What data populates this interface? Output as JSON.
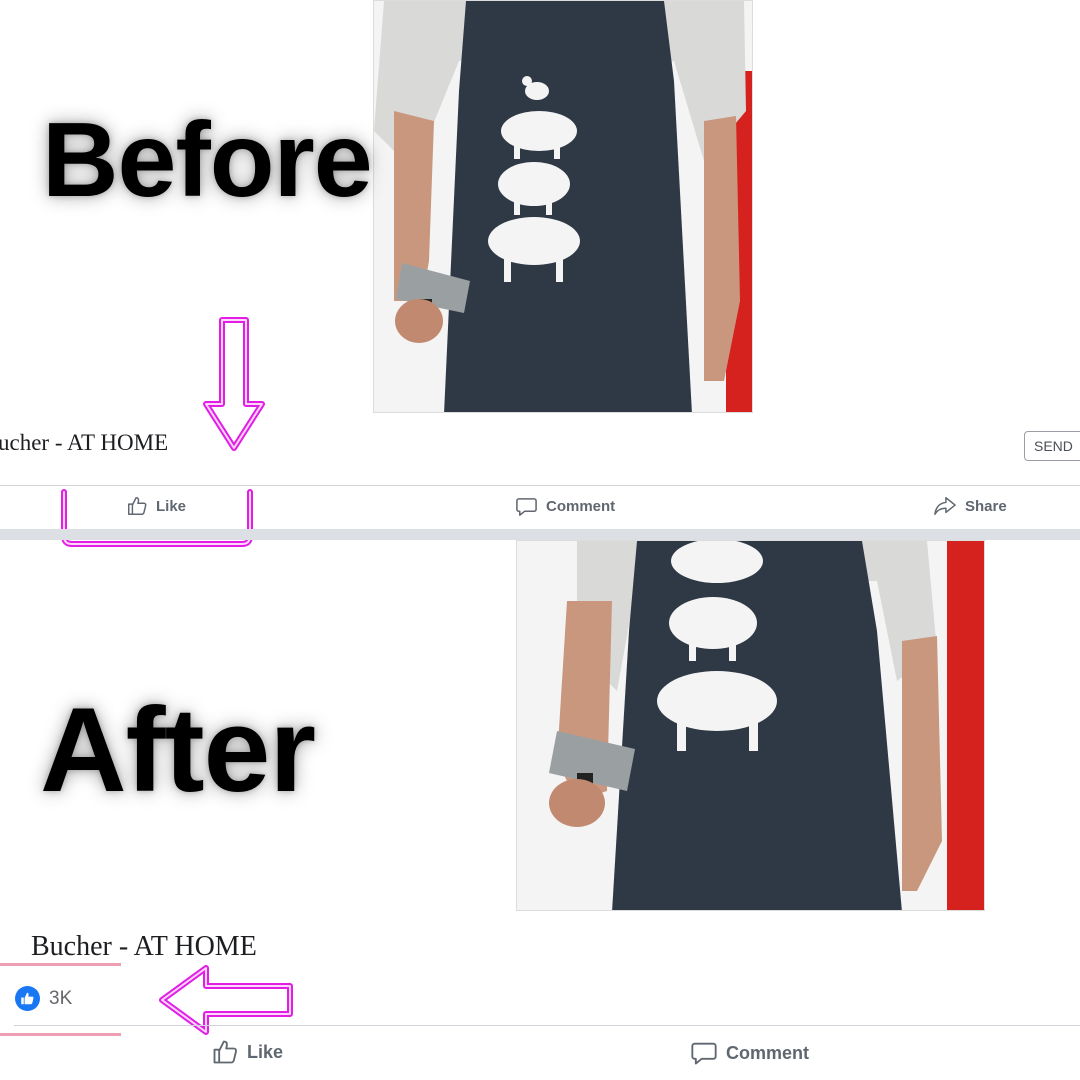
{
  "before": {
    "label": "Before",
    "post_title": "ucher - AT HOME",
    "send_label": "SEND",
    "actions": {
      "like": "Like",
      "comment": "Comment",
      "share": "Share"
    }
  },
  "after": {
    "label": "After",
    "post_title": "Bucher - AT HOME",
    "like_count": "3K",
    "actions": {
      "like": "Like",
      "comment": "Comment"
    }
  },
  "icons": {
    "like": "thumbs-up-outline-icon",
    "comment": "speech-bubble-icon",
    "share": "share-arrow-icon",
    "reaction": "blue-thumbs-up-reaction-icon",
    "arrow_down": "neon-arrow-down-icon",
    "arrow_left": "neon-arrow-left-icon"
  },
  "colors": {
    "neon": "#e21ee6",
    "apron": "#2f3946",
    "reaction_blue": "#1877f2",
    "backdrop_red": "#d6221f"
  }
}
